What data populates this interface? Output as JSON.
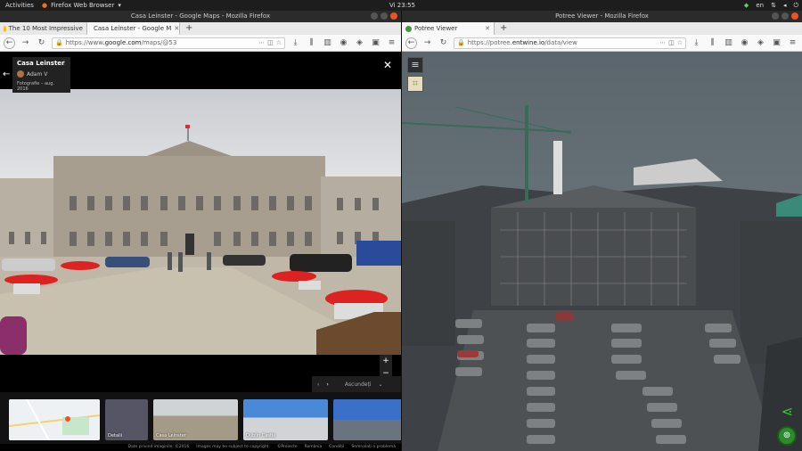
{
  "system": {
    "activities": "Activities",
    "app_name": "Firefox Web Browser",
    "clock": "Vi 23:55",
    "lang": "en"
  },
  "left": {
    "window_title": "Casa Leinster - Google Maps - Mozilla Firefox",
    "tabs": [
      {
        "label": "The 10 Most Impressive"
      },
      {
        "label": "Casa Leinster - Google M"
      }
    ],
    "url_prefix": "https://www.",
    "url_host": "google.com",
    "url_path": "/maps/@53",
    "place": {
      "title": "Casa Leinster",
      "author": "Adam V",
      "date": "Fotografie – aug. 2016"
    },
    "nav": {
      "label": "Ascundeți"
    },
    "thumbs": [
      {
        "label": ""
      },
      {
        "label": "Detalii"
      },
      {
        "label": "Casa Leinster"
      },
      {
        "label": "Dublin Castle"
      },
      {
        "label": ""
      }
    ],
    "footer": [
      "Date privind imaginile: ©2016",
      "Images may be subject to copyright.",
      "©Proiecte",
      "România",
      "Condiții",
      "Semnalați o problemă"
    ]
  },
  "right": {
    "window_title": "Potree Viewer - Mozilla Firefox",
    "tabs": [
      {
        "label": "Potree Viewer"
      }
    ],
    "url_prefix": "https://potree.",
    "url_host": "entwine.io",
    "url_path": "/data/view"
  }
}
